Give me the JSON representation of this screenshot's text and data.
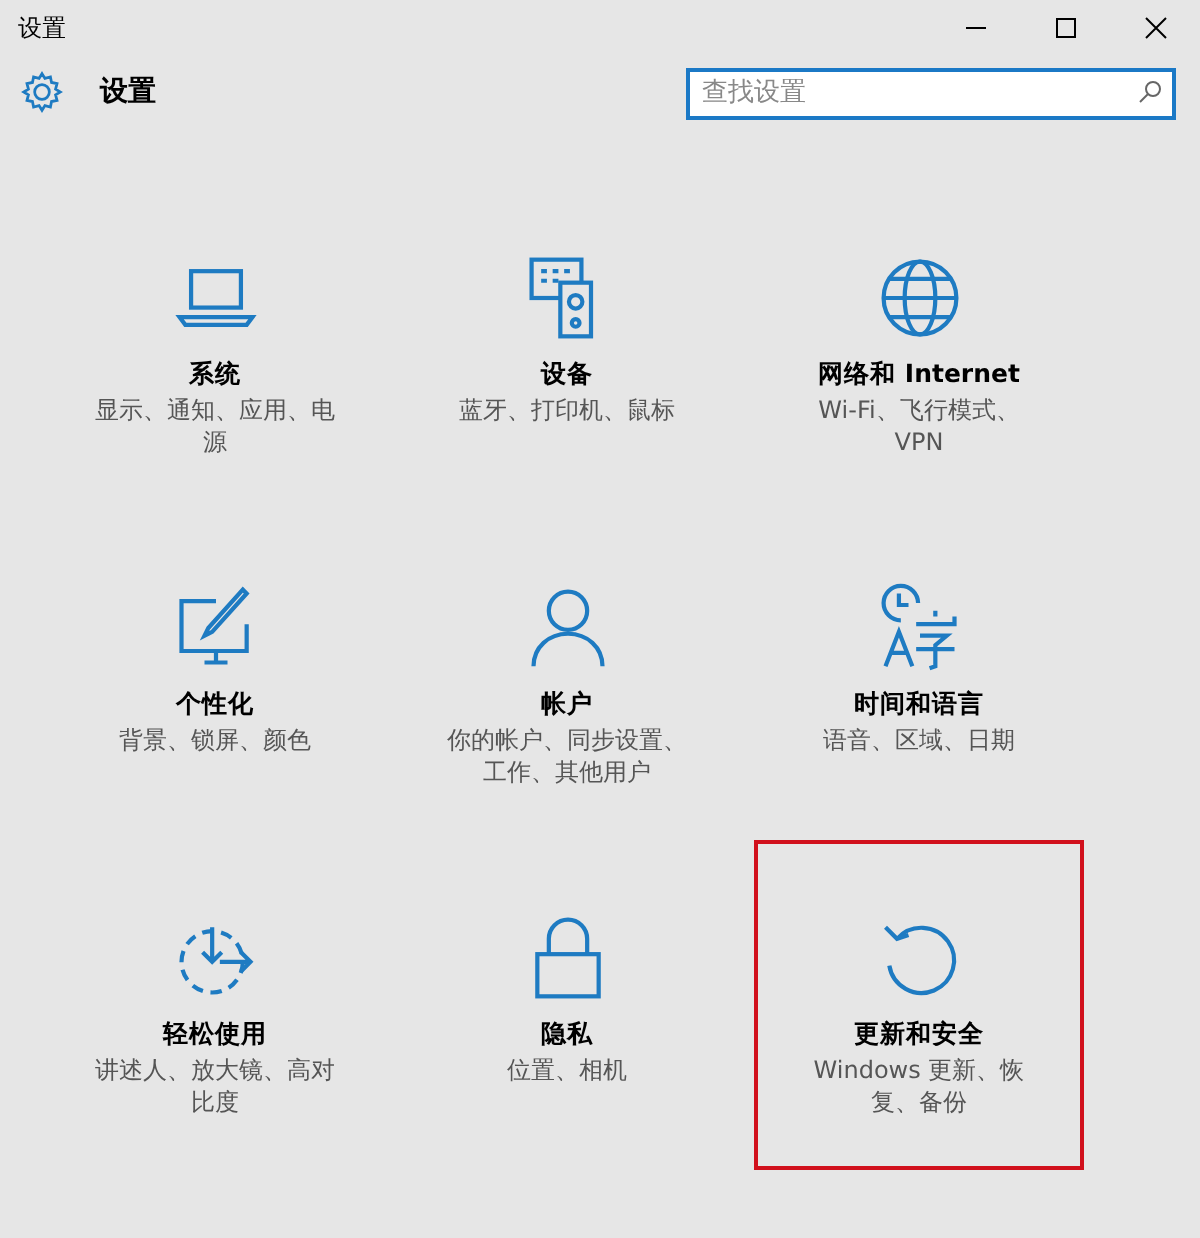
{
  "window": {
    "title": "设置"
  },
  "header": {
    "title": "设置",
    "search": {
      "placeholder": "查找设置"
    }
  },
  "tiles": [
    {
      "title": "系统",
      "description": "显示、通知、应用、电源",
      "highlighted": false
    },
    {
      "title": "设备",
      "description": "蓝牙、打印机、鼠标",
      "highlighted": false
    },
    {
      "title": "网络和 Internet",
      "description": "Wi-Fi、飞行模式、VPN",
      "highlighted": false
    },
    {
      "title": "个性化",
      "description": "背景、锁屏、颜色",
      "highlighted": false
    },
    {
      "title": "帐户",
      "description": "你的帐户、同步设置、工作、其他用户",
      "highlighted": false
    },
    {
      "title": "时间和语言",
      "description": "语音、区域、日期",
      "highlighted": false
    },
    {
      "title": "轻松使用",
      "description": "讲述人、放大镜、高对比度",
      "highlighted": false
    },
    {
      "title": "隐私",
      "description": "位置、相机",
      "highlighted": false
    },
    {
      "title": "更新和安全",
      "description": "Windows 更新、恢复、备份",
      "highlighted": true
    }
  ]
}
